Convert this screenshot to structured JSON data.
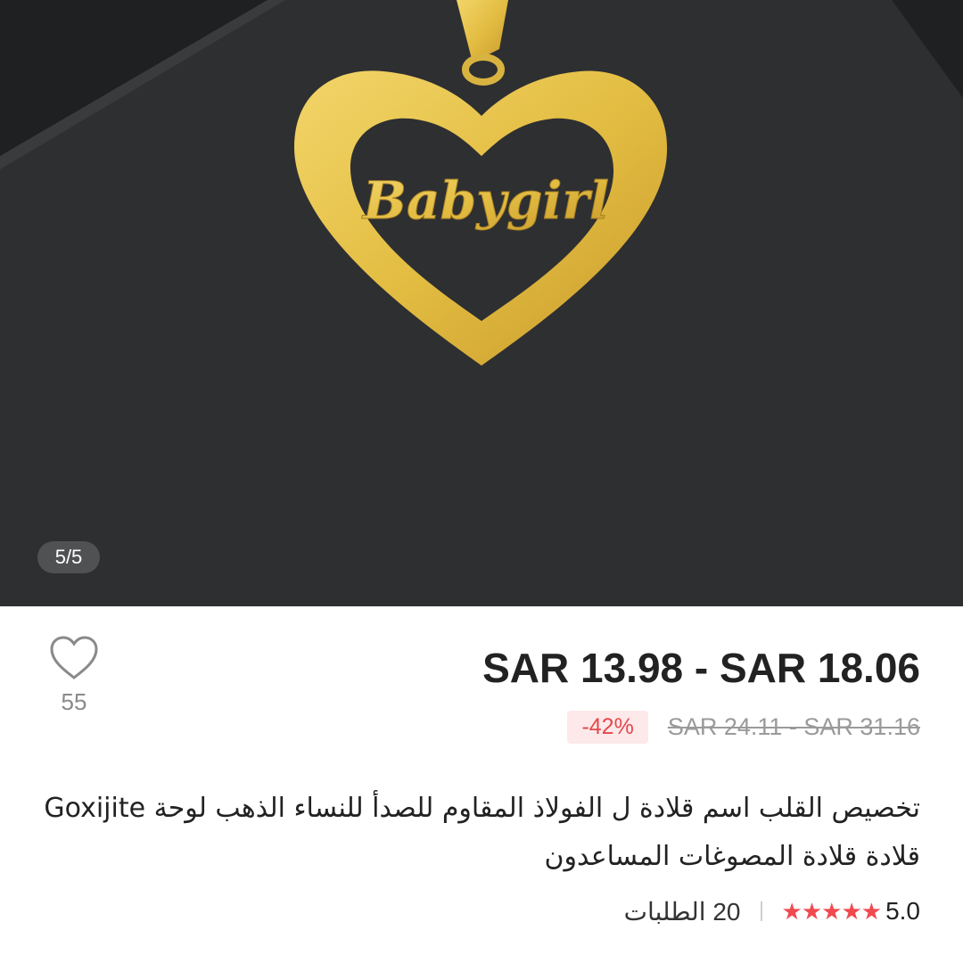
{
  "gallery": {
    "counter": "5/5",
    "pendant_text": "Babygirl",
    "colors": {
      "board": "#2e2f31",
      "gold": "#e7c347",
      "gold_dark": "#b8912a"
    }
  },
  "wishlist": {
    "icon": "heart-outline-icon",
    "count": "55"
  },
  "price": {
    "current": "SAR 13.98 - SAR 18.06",
    "original": "SAR 24.11 - SAR 31.16",
    "discount": "-42%",
    "discount_color": "#e5484d"
  },
  "title": {
    "line1": "تخصيص القلب اسم قلادة ل الفولاذ المقاوم للصدأ للنساء الذهب لوحة Goxijite",
    "line2": "قلادة قلادة المصوغات المساعدون"
  },
  "meta": {
    "rating": "5.0",
    "stars": 5,
    "star_icon": "star-icon",
    "star_color": "#f04a4f",
    "orders": "20 الطلبات"
  }
}
